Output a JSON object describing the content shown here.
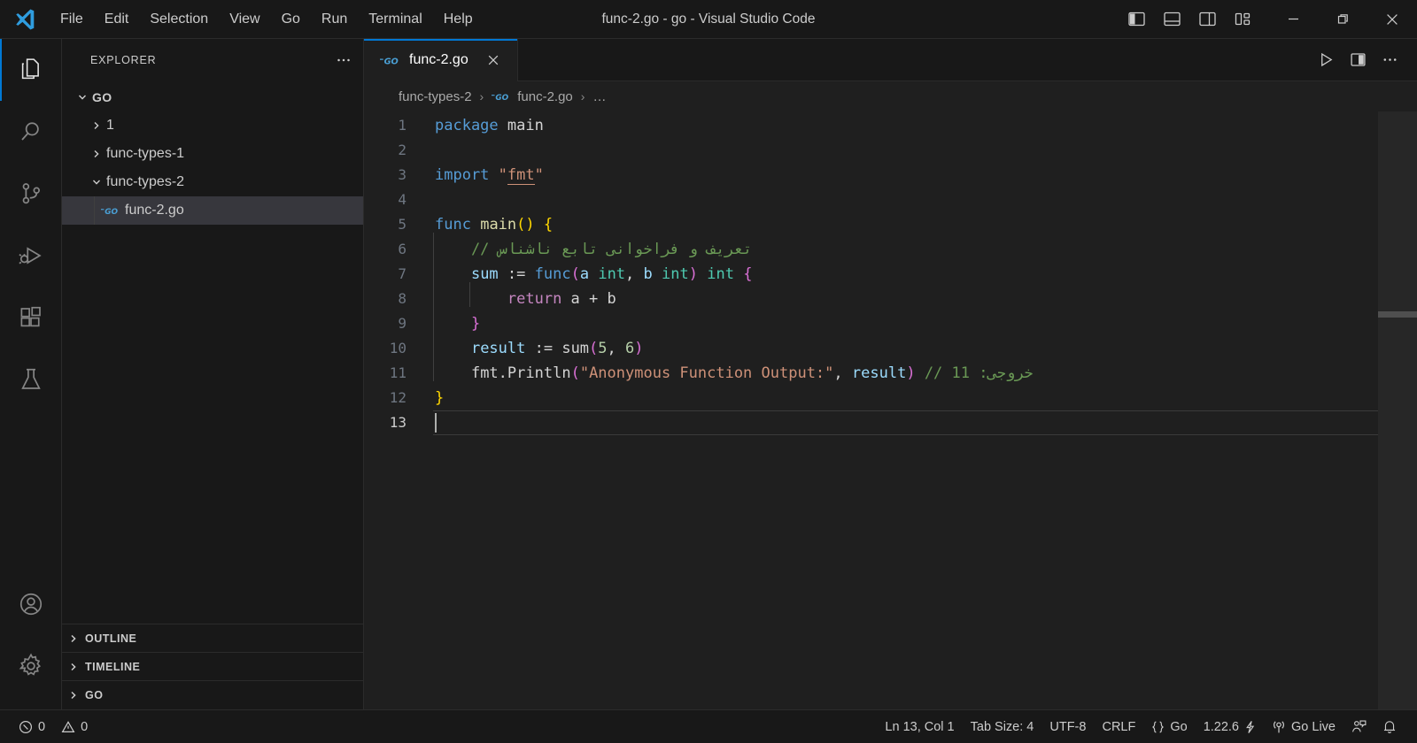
{
  "window": {
    "title": "func-2.go - go - Visual Studio Code",
    "menus": [
      "File",
      "Edit",
      "Selection",
      "View",
      "Go",
      "Run",
      "Terminal",
      "Help"
    ],
    "layout_buttons": [
      {
        "name": "toggle-primary-sidebar",
        "tooltip": "Toggle Primary Side Bar"
      },
      {
        "name": "toggle-panel",
        "tooltip": "Toggle Panel"
      },
      {
        "name": "toggle-secondary-sidebar",
        "tooltip": "Toggle Secondary Side Bar"
      },
      {
        "name": "customize-layout",
        "tooltip": "Customize Layout"
      }
    ],
    "controls": [
      "minimize",
      "restore",
      "close"
    ]
  },
  "activity_bar": {
    "top": [
      {
        "name": "explorer",
        "label": "Explorer",
        "active": true
      },
      {
        "name": "search",
        "label": "Search",
        "active": false
      },
      {
        "name": "source-control",
        "label": "Source Control",
        "active": false
      },
      {
        "name": "run-and-debug",
        "label": "Run and Debug",
        "active": false
      },
      {
        "name": "extensions",
        "label": "Extensions",
        "active": false
      },
      {
        "name": "testing",
        "label": "Testing",
        "active": false
      }
    ],
    "bottom": [
      {
        "name": "accounts",
        "label": "Accounts"
      },
      {
        "name": "manage",
        "label": "Manage"
      }
    ]
  },
  "sidebar": {
    "header": "EXPLORER",
    "more_actions": "…",
    "tree": [
      {
        "label": "GO",
        "type": "root",
        "expanded": true,
        "depth": 0,
        "selected": false
      },
      {
        "label": "1",
        "type": "folder",
        "expanded": false,
        "depth": 1,
        "selected": false
      },
      {
        "label": "func-types-1",
        "type": "folder",
        "expanded": false,
        "depth": 1,
        "selected": false
      },
      {
        "label": "func-types-2",
        "type": "folder",
        "expanded": true,
        "depth": 1,
        "selected": false
      },
      {
        "label": "func-2.go",
        "type": "file",
        "icon": "go-file-icon",
        "depth": 2,
        "selected": true
      }
    ],
    "sections": [
      "OUTLINE",
      "TIMELINE",
      "GO"
    ]
  },
  "editor": {
    "tab": {
      "label": "func-2.go",
      "icon": "go-file-icon",
      "close": "✕"
    },
    "actions": [
      {
        "name": "run-code-button",
        "label": "Run Code"
      },
      {
        "name": "split-editor-right-button",
        "label": "Split Editor Right"
      },
      {
        "name": "more-actions-button",
        "label": "More Actions..."
      }
    ],
    "breadcrumbs": [
      {
        "label": "func-types-2",
        "icon": null
      },
      {
        "label": "func-2.go",
        "icon": "go-file-icon"
      },
      {
        "label": "…",
        "icon": null
      }
    ],
    "active_line": 13,
    "lines": [
      {
        "n": 1,
        "tokens": [
          {
            "t": "package",
            "c": "t-kw"
          },
          {
            "t": " ",
            "c": "t-plain"
          },
          {
            "t": "main",
            "c": "t-plain"
          }
        ]
      },
      {
        "n": 2,
        "tokens": []
      },
      {
        "n": 3,
        "tokens": [
          {
            "t": "import",
            "c": "t-kw"
          },
          {
            "t": " ",
            "c": "t-plain"
          },
          {
            "t": "\"",
            "c": "t-str"
          },
          {
            "t": "fmt",
            "c": "t-pkg"
          },
          {
            "t": "\"",
            "c": "t-str"
          }
        ]
      },
      {
        "n": 4,
        "tokens": []
      },
      {
        "n": 5,
        "tokens": [
          {
            "t": "func",
            "c": "t-kw"
          },
          {
            "t": " ",
            "c": "t-plain"
          },
          {
            "t": "main",
            "c": "t-fn"
          },
          {
            "t": "()",
            "c": "t-paren"
          },
          {
            "t": " ",
            "c": "t-plain"
          },
          {
            "t": "{",
            "c": "t-paren"
          }
        ]
      },
      {
        "n": 6,
        "indent": 1,
        "tokens": [
          {
            "t": "    // تعریف و فراخوانی تابع ناشناس",
            "c": "t-com"
          }
        ]
      },
      {
        "n": 7,
        "indent": 1,
        "tokens": [
          {
            "t": "    ",
            "c": "t-plain"
          },
          {
            "t": "sum",
            "c": "t-id"
          },
          {
            "t": " := ",
            "c": "t-plain"
          },
          {
            "t": "func",
            "c": "t-kw"
          },
          {
            "t": "(",
            "c": "t-paren2"
          },
          {
            "t": "a",
            "c": "t-id"
          },
          {
            "t": " ",
            "c": "t-plain"
          },
          {
            "t": "int",
            "c": "t-type"
          },
          {
            "t": ", ",
            "c": "t-plain"
          },
          {
            "t": "b",
            "c": "t-id"
          },
          {
            "t": " ",
            "c": "t-plain"
          },
          {
            "t": "int",
            "c": "t-type"
          },
          {
            "t": ")",
            "c": "t-paren2"
          },
          {
            "t": " ",
            "c": "t-plain"
          },
          {
            "t": "int",
            "c": "t-type"
          },
          {
            "t": " ",
            "c": "t-plain"
          },
          {
            "t": "{",
            "c": "t-paren2"
          }
        ]
      },
      {
        "n": 8,
        "indent": 2,
        "tokens": [
          {
            "t": "        ",
            "c": "t-plain"
          },
          {
            "t": "return",
            "c": "t-kw2"
          },
          {
            "t": " a + b",
            "c": "t-plain"
          }
        ]
      },
      {
        "n": 9,
        "indent": 1,
        "tokens": [
          {
            "t": "    ",
            "c": "t-plain"
          },
          {
            "t": "}",
            "c": "t-paren2"
          }
        ]
      },
      {
        "n": 10,
        "indent": 1,
        "tokens": [
          {
            "t": "    ",
            "c": "t-plain"
          },
          {
            "t": "result",
            "c": "t-id"
          },
          {
            "t": " := ",
            "c": "t-plain"
          },
          {
            "t": "sum",
            "c": "t-plain"
          },
          {
            "t": "(",
            "c": "t-paren2"
          },
          {
            "t": "5",
            "c": "t-num"
          },
          {
            "t": ", ",
            "c": "t-plain"
          },
          {
            "t": "6",
            "c": "t-num"
          },
          {
            "t": ")",
            "c": "t-paren2"
          }
        ]
      },
      {
        "n": 11,
        "indent": 1,
        "tokens": [
          {
            "t": "    ",
            "c": "t-plain"
          },
          {
            "t": "fmt",
            "c": "t-plain"
          },
          {
            "t": ".",
            "c": "t-plain"
          },
          {
            "t": "Println",
            "c": "t-plain"
          },
          {
            "t": "(",
            "c": "t-paren2"
          },
          {
            "t": "\"Anonymous Function Output:\"",
            "c": "t-str"
          },
          {
            "t": ", ",
            "c": "t-plain"
          },
          {
            "t": "result",
            "c": "t-id"
          },
          {
            "t": ")",
            "c": "t-paren2"
          },
          {
            "t": " ",
            "c": "t-plain"
          },
          {
            "t": "// خروجی: 11",
            "c": "t-com"
          }
        ]
      },
      {
        "n": 12,
        "tokens": [
          {
            "t": "}",
            "c": "t-paren"
          }
        ]
      },
      {
        "n": 13,
        "tokens": []
      }
    ]
  },
  "status_bar": {
    "left": [
      {
        "name": "problems-errors",
        "icon": "error-circle-icon",
        "label": "0"
      },
      {
        "name": "problems-warnings",
        "icon": "warning-triangle-icon",
        "label": "0"
      }
    ],
    "right": [
      {
        "name": "editor-position",
        "label": "Ln 13, Col 1"
      },
      {
        "name": "editor-indentation",
        "label": "Tab Size: 4"
      },
      {
        "name": "editor-encoding",
        "label": "UTF-8"
      },
      {
        "name": "editor-eol",
        "label": "CRLF"
      },
      {
        "name": "editor-language",
        "label": "Go",
        "icon": "braces-icon"
      },
      {
        "name": "go-version",
        "label": "1.22.6",
        "icon": "zap-icon"
      },
      {
        "name": "go-live",
        "label": "Go Live",
        "icon": "broadcast-icon"
      },
      {
        "name": "feedback",
        "label": "",
        "icon": "feedback-icon"
      },
      {
        "name": "notifications",
        "label": "",
        "icon": "bell-icon"
      }
    ]
  },
  "colors": {
    "accent": "#0078d4",
    "titlebar_bg": "#181818",
    "editor_bg": "#1f1f1f",
    "sidebar_bg": "#181818",
    "selection_bg": "#37373d",
    "go_blue": "#4a9fd4"
  }
}
